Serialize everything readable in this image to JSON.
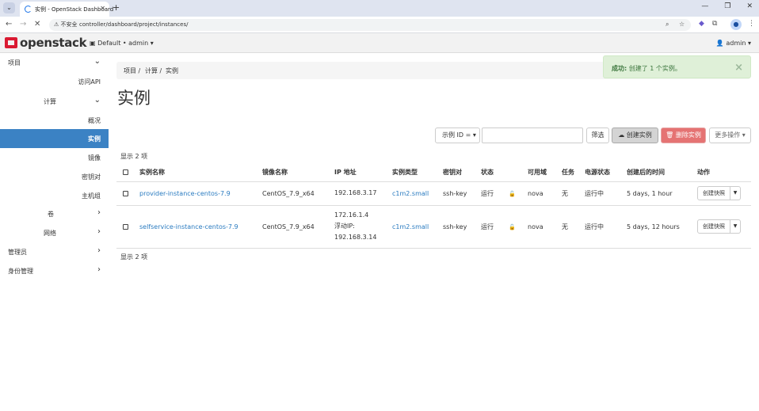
{
  "browser": {
    "tab_title": "实例 - OpenStack Dashboard",
    "insecure_label": "不安全",
    "url": "controller/dashboard/project/instances/"
  },
  "header": {
    "logo_text": "openstack",
    "project_selector": "Default • admin ▾",
    "user_menu": "admin ▾"
  },
  "sidebar": {
    "items": [
      {
        "label": "项目",
        "chevron": "⌄"
      },
      {
        "label": "访问API",
        "chevron": ""
      },
      {
        "label": "计算",
        "chevron": "⌄"
      },
      {
        "label": "概况",
        "chevron": ""
      },
      {
        "label": "实例",
        "chevron": ""
      },
      {
        "label": "镜像",
        "chevron": ""
      },
      {
        "label": "密钥对",
        "chevron": ""
      },
      {
        "label": "主机组",
        "chevron": ""
      },
      {
        "label": "卷",
        "chevron": "›"
      },
      {
        "label": "网络",
        "chevron": "›"
      },
      {
        "label": "管理员",
        "chevron": "›"
      },
      {
        "label": "身份管理",
        "chevron": "›"
      }
    ]
  },
  "breadcrumb": {
    "items": [
      "项目 /",
      "计算 /",
      "实例"
    ]
  },
  "page_title": "实例",
  "alert": {
    "prefix": "成功:",
    "message": "创建了 1 个实例。",
    "close": "×"
  },
  "toolbar": {
    "filter_field": "示例 ID = ▾",
    "filter_value": "",
    "filter_button": "筛选",
    "create_button": "创建实例",
    "delete_button": "删除实例",
    "more_button": "更多操作 ▾"
  },
  "count_text": "显示 2 项",
  "table": {
    "headers": [
      "实例名称",
      "镜像名称",
      "IP 地址",
      "实例类型",
      "密钥对",
      "状态",
      "",
      "可用域",
      "任务",
      "电源状态",
      "创建后的时间",
      "动作"
    ],
    "rows": [
      {
        "name": "provider-instance-centos-7.9",
        "image": "CentOS_7.9_x64",
        "ip": [
          "192.168.3.17"
        ],
        "flavor": "c1m2.small",
        "keypair": "ssh-key",
        "status": "运行",
        "zone": "nova",
        "task": "无",
        "power": "运行中",
        "age": "5 days, 1 hour",
        "action": "创建快照"
      },
      {
        "name": "selfservice-instance-centos-7.9",
        "image": "CentOS_7.9_x64",
        "ip": [
          "172.16.1.4",
          "浮动IP:",
          "192.168.3.14"
        ],
        "flavor": "c1m2.small",
        "keypair": "ssh-key",
        "status": "运行",
        "zone": "nova",
        "task": "无",
        "power": "运行中",
        "age": "5 days, 12 hours",
        "action": "创建快照"
      }
    ]
  },
  "colors": {
    "sidebar_active": "#3b82c4",
    "link": "#2a7bc0",
    "delete": "#e57373",
    "success_bg": "#dff0d8",
    "logo_red": "#da1a32"
  }
}
